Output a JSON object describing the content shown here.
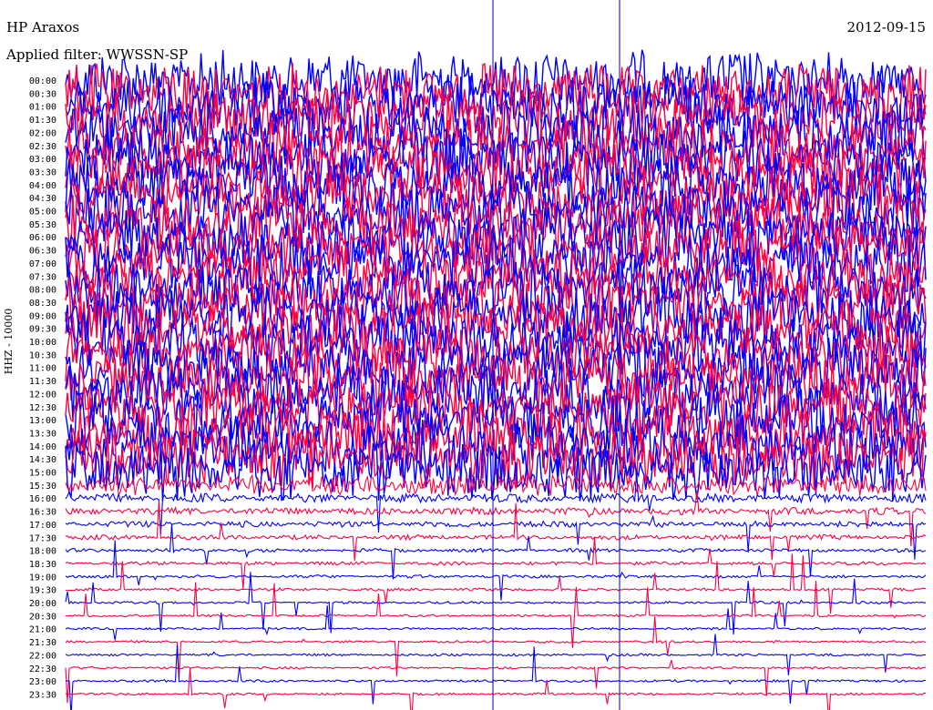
{
  "header": {
    "station": "HP Araxos",
    "date": "2012-09-15",
    "filter": "Applied filter: WWSSN-SP",
    "channel_label": "HHZ - 10000"
  },
  "colors": {
    "trace_a": "#0000ff",
    "trace_b": "#ff0040",
    "marker": "#0000c8",
    "text": "#000000"
  },
  "chart_data": {
    "type": "line",
    "title": "HP Araxos",
    "subtitle": "Applied filter: WWSSN-SP",
    "ylabel": "HHZ - 10000",
    "row_labels": [
      "00:00",
      "00:30",
      "01:00",
      "01:30",
      "02:00",
      "02:30",
      "03:00",
      "03:30",
      "04:00",
      "04:30",
      "05:00",
      "05:30",
      "06:00",
      "06:30",
      "07:00",
      "07:30",
      "08:00",
      "08:30",
      "09:00",
      "09:30",
      "10:00",
      "10:30",
      "11:00",
      "11:30",
      "12:00",
      "12:30",
      "13:00",
      "13:30",
      "14:00",
      "14:30",
      "15:00",
      "15:30",
      "16:00",
      "16:30",
      "17:00",
      "17:30",
      "18:00",
      "18:30",
      "19:00",
      "19:30",
      "20:00",
      "20:30",
      "21:00",
      "21:30",
      "22:00",
      "22:30",
      "23:00",
      "23:30"
    ],
    "trace_colors": [
      "#0000ff",
      "#ff0040"
    ],
    "relative_amplitude": [
      1.0,
      1.0,
      1.0,
      1.0,
      1.0,
      1.0,
      1.0,
      1.0,
      1.0,
      1.0,
      1.0,
      1.0,
      1.0,
      1.0,
      1.0,
      1.0,
      1.0,
      1.0,
      1.0,
      1.0,
      1.0,
      1.0,
      1.0,
      1.0,
      1.0,
      1.0,
      1.0,
      1.0,
      1.0,
      1.0,
      1.0,
      0.35,
      0.15,
      0.12,
      0.1,
      0.08,
      0.06,
      0.06,
      0.05,
      0.05,
      0.04,
      0.04,
      0.04,
      0.04,
      0.04,
      0.04,
      0.04,
      0.04
    ],
    "grid": false
  }
}
